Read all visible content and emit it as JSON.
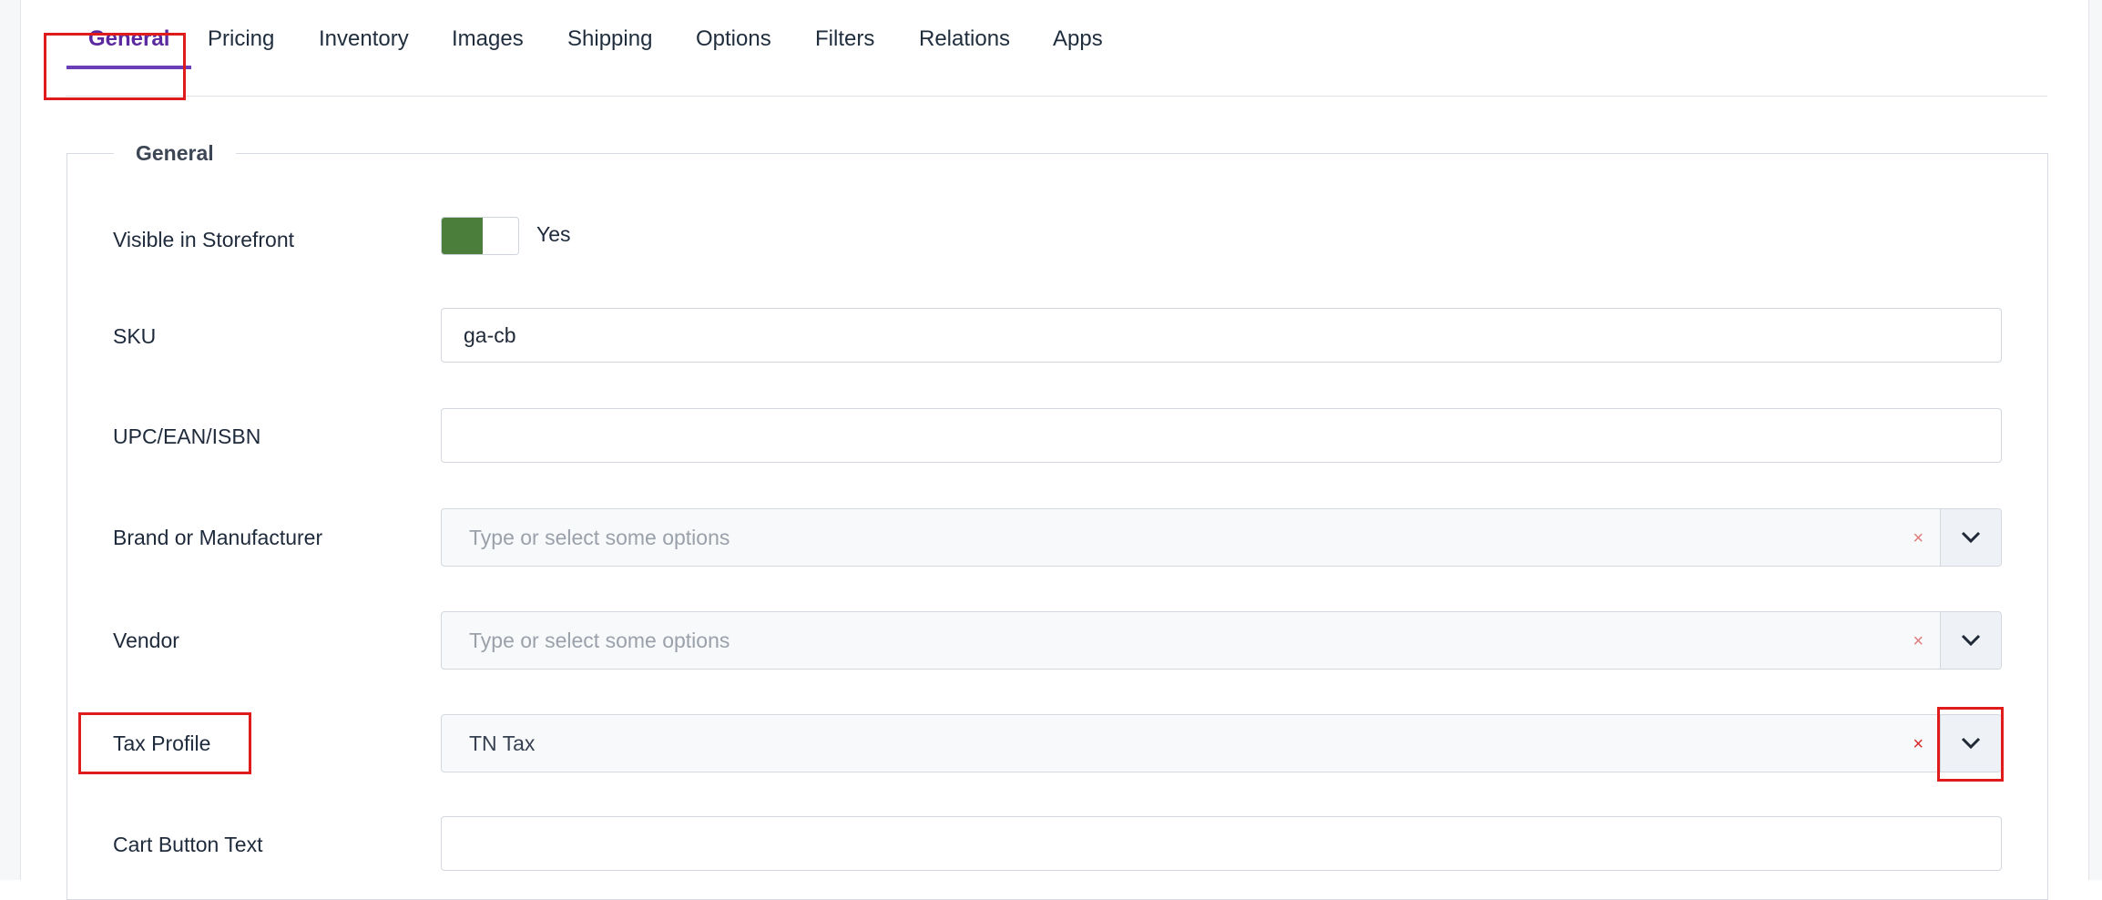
{
  "tabs": [
    {
      "label": "General"
    },
    {
      "label": "Pricing"
    },
    {
      "label": "Inventory"
    },
    {
      "label": "Images"
    },
    {
      "label": "Shipping"
    },
    {
      "label": "Options"
    },
    {
      "label": "Filters"
    },
    {
      "label": "Relations"
    },
    {
      "label": "Apps"
    }
  ],
  "active_tab": "General",
  "section": {
    "legend": "General"
  },
  "fields": {
    "visible": {
      "label": "Visible in Storefront",
      "value_text": "Yes",
      "checked": true
    },
    "sku": {
      "label": "SKU",
      "value": "ga-cb"
    },
    "upc": {
      "label": "UPC/EAN/ISBN",
      "value": ""
    },
    "brand": {
      "label": "Brand or Manufacturer",
      "placeholder": "Type or select some options",
      "clear": "×"
    },
    "vendor": {
      "label": "Vendor",
      "placeholder": "Type or select some options",
      "clear": "×"
    },
    "tax": {
      "label": "Tax Profile",
      "value": "TN Tax",
      "clear": "×"
    },
    "cart_button": {
      "label": "Cart Button Text",
      "value": ""
    }
  },
  "colors": {
    "accent": "#6a3fb8",
    "toggle_on": "#4a7e3a",
    "highlight": "#e01b1b"
  }
}
